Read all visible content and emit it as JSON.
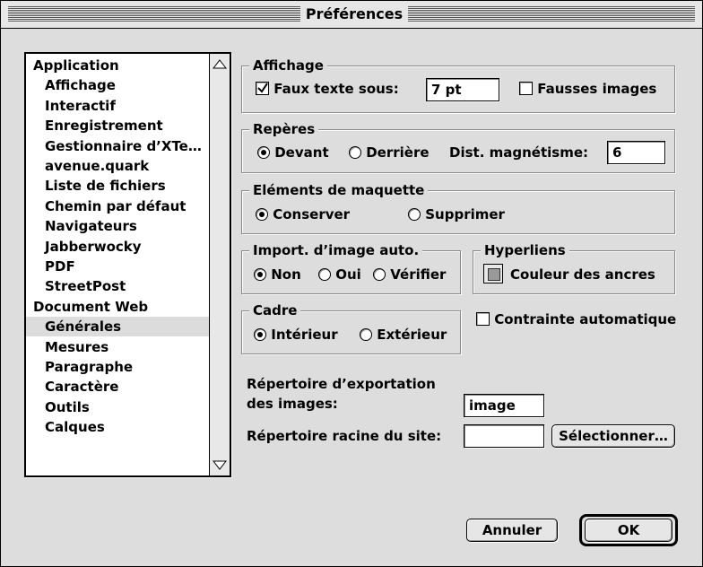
{
  "window": {
    "title": "Préférences"
  },
  "sidebar": {
    "items": [
      {
        "label": "Application",
        "level": 0
      },
      {
        "label": "Affichage",
        "level": 1
      },
      {
        "label": "Interactif",
        "level": 1
      },
      {
        "label": "Enregistrement",
        "level": 1
      },
      {
        "label": "Gestionnaire d’XTe…",
        "level": 1
      },
      {
        "label": "avenue.quark",
        "level": 1
      },
      {
        "label": "Liste de fichiers",
        "level": 1
      },
      {
        "label": "Chemin par défaut",
        "level": 1
      },
      {
        "label": "Navigateurs",
        "level": 1
      },
      {
        "label": "Jabberwocky",
        "level": 1
      },
      {
        "label": "PDF",
        "level": 1
      },
      {
        "label": "StreetPost",
        "level": 1
      },
      {
        "label": "Document Web",
        "level": 0
      },
      {
        "label": "Générales",
        "level": 1,
        "selected": true
      },
      {
        "label": "Mesures",
        "level": 1
      },
      {
        "label": "Paragraphe",
        "level": 1
      },
      {
        "label": "Caractère",
        "level": 1
      },
      {
        "label": "Outils",
        "level": 1
      },
      {
        "label": "Calques",
        "level": 1
      }
    ]
  },
  "affichage": {
    "title": "Affichage",
    "faux_texte_label": "Faux texte sous:",
    "faux_texte_checked": true,
    "faux_texte_value": "7  pt",
    "fausses_images_label": "Fausses images",
    "fausses_images_checked": false
  },
  "reperes": {
    "title": "Repères",
    "devant_label": "Devant",
    "derriere_label": "Derrière",
    "selected": "Devant",
    "dist_label": "Dist. magnétisme:",
    "dist_value": "6"
  },
  "maquette": {
    "title": "Eléments de maquette",
    "conserver_label": "Conserver",
    "supprimer_label": "Supprimer",
    "selected": "Conserver"
  },
  "import": {
    "title": "Import. d’image auto.",
    "non_label": "Non",
    "oui_label": "Oui",
    "verifier_label": "Vérifier",
    "selected": "Non"
  },
  "hyperliens": {
    "title": "Hyperliens",
    "couleur_label": "Couleur des ancres"
  },
  "cadre": {
    "title": "Cadre",
    "interieur_label": "Intérieur",
    "exterieur_label": "Extérieur",
    "selected": "Intérieur"
  },
  "contrainte": {
    "label": "Contrainte automatique",
    "checked": false
  },
  "export": {
    "label_line1": "Répertoire d’exportation",
    "label_line2": "des images:",
    "value": "image"
  },
  "racine": {
    "label": "Répertoire racine du site:",
    "value": "",
    "select_button": "Sélectionner…"
  },
  "footer": {
    "cancel_label": "Annuler",
    "ok_label": "OK"
  }
}
